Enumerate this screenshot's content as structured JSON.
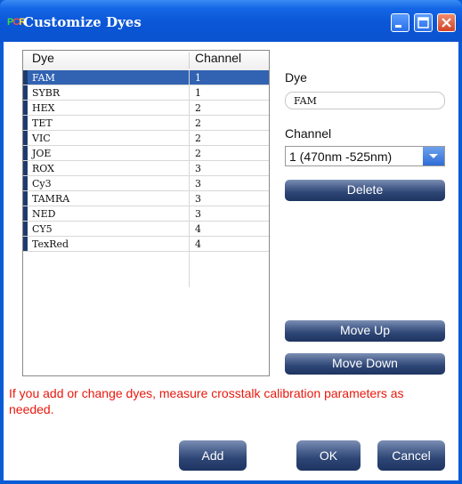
{
  "window": {
    "title": "Customize Dyes",
    "icon_letters": [
      "P",
      "C",
      "R"
    ]
  },
  "table": {
    "headers": [
      "Dye",
      "Channel"
    ],
    "rows": [
      {
        "dye": "FAM",
        "channel": "1"
      },
      {
        "dye": "SYBR",
        "channel": "1"
      },
      {
        "dye": "HEX",
        "channel": "2"
      },
      {
        "dye": "TET",
        "channel": "2"
      },
      {
        "dye": "VIC",
        "channel": "2"
      },
      {
        "dye": "JOE",
        "channel": "2"
      },
      {
        "dye": "ROX",
        "channel": "3"
      },
      {
        "dye": "Cy3",
        "channel": "3"
      },
      {
        "dye": "TAMRA",
        "channel": "3"
      },
      {
        "dye": "NED",
        "channel": "3"
      },
      {
        "dye": "CY5",
        "channel": "4"
      },
      {
        "dye": "TexRed",
        "channel": "4"
      }
    ],
    "selected_index": 0
  },
  "form": {
    "dye_label": "Dye",
    "dye_value": "FAM",
    "channel_label": "Channel",
    "channel_value": "1 (470nm -525nm)"
  },
  "buttons": {
    "delete": "Delete",
    "move_up": "Move Up",
    "move_down": "Move Down",
    "add": "Add",
    "ok": "OK",
    "cancel": "Cancel"
  },
  "warning": "If you add or change dyes, measure crosstalk calibration parameters as needed.",
  "colors": {
    "selection": "#3163b2",
    "warning_text": "#e8180d",
    "title_bar": "#0a56d6"
  }
}
